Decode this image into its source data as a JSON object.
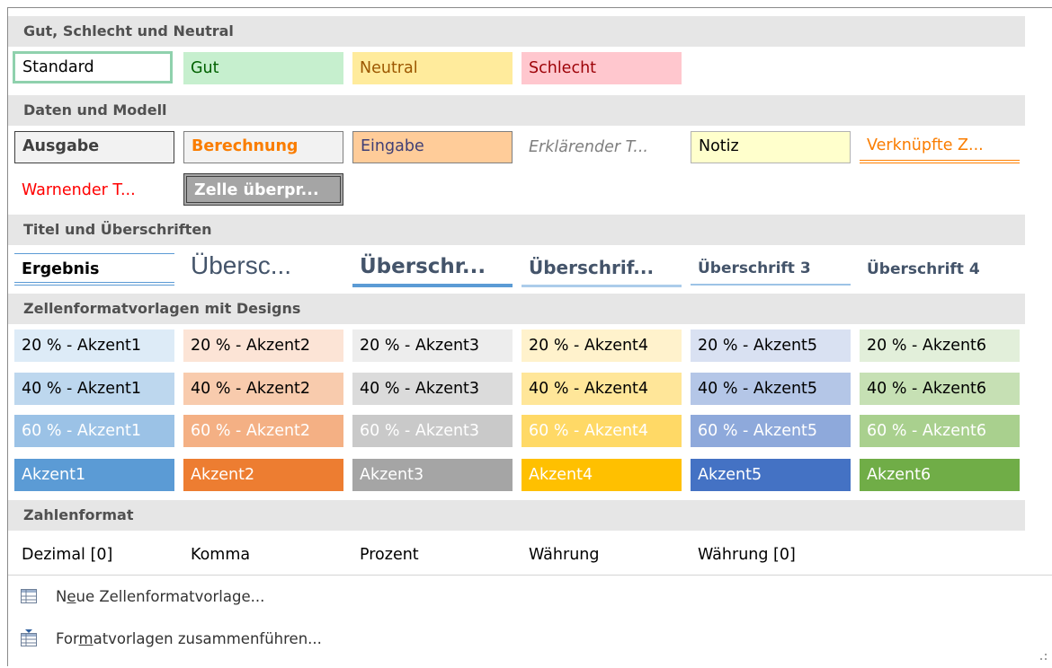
{
  "groups": {
    "good_bad_neutral": "Gut, Schlecht und Neutral",
    "data_model": "Daten und Modell",
    "titles": "Titel und Überschriften",
    "themed": "Zellenformatvorlagen mit Designs",
    "number_format": "Zahlenformat"
  },
  "gbn": {
    "standard": "Standard",
    "good": "Gut",
    "neutral": "Neutral",
    "bad": "Schlecht"
  },
  "data": {
    "output": "Ausgabe",
    "calculation": "Berechnung",
    "input": "Eingabe",
    "explanatory": "Erklärender T...",
    "note": "Notiz",
    "linked": "Verknüpfte Z...",
    "warning": "Warnender T...",
    "check": "Zelle überpr..."
  },
  "titles": {
    "total": "Ergebnis",
    "title": "Übersc...",
    "h1": "Überschr...",
    "h2": "Überschrif...",
    "h3": "Überschrift 3",
    "h4": "Überschrift 4"
  },
  "themed": {
    "row20": [
      "20 % - Akzent1",
      "20 % - Akzent2",
      "20 % - Akzent3",
      "20 % - Akzent4",
      "20 % - Akzent5",
      "20 % - Akzent6"
    ],
    "row40": [
      "40 % - Akzent1",
      "40 % - Akzent2",
      "40 % - Akzent3",
      "40 % - Akzent4",
      "40 % - Akzent5",
      "40 % - Akzent6"
    ],
    "row60": [
      "60 % - Akzent1",
      "60 % - Akzent2",
      "60 % - Akzent3",
      "60 % - Akzent4",
      "60 % - Akzent5",
      "60 % - Akzent6"
    ],
    "row100": [
      "Akzent1",
      "Akzent2",
      "Akzent3",
      "Akzent4",
      "Akzent5",
      "Akzent6"
    ]
  },
  "numbers": {
    "comma0": "Dezimal [0]",
    "comma": "Komma",
    "percent": "Prozent",
    "currency": "Währung",
    "currency0": "Währung [0]"
  },
  "footer": {
    "new_style_pre": "N",
    "new_style_u": "e",
    "new_style_post": "ue Zellenformatvorlage...",
    "merge_pre": "For",
    "merge_u": "m",
    "merge_post": "atvorlagen zusammenführen..."
  },
  "colors": {
    "accent1": "#5b9bd5",
    "accent2": "#ed7d31",
    "accent3": "#a5a5a5",
    "accent4": "#ffc000",
    "accent5": "#4472c4",
    "accent6": "#70ad47",
    "good_bg": "#c6efce",
    "good_fg": "#006100",
    "neutral_bg": "#ffeb9c",
    "neutral_fg": "#9c5700",
    "bad_bg": "#ffc7ce",
    "bad_fg": "#9c0006"
  }
}
